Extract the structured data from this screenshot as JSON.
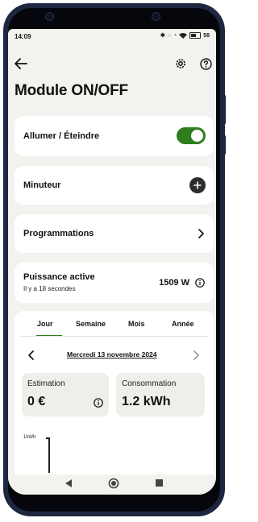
{
  "status_bar": {
    "time": "14:09",
    "battery": "58"
  },
  "page": {
    "title": "Module ON/OFF"
  },
  "icons": {
    "back": "arrow-left-icon",
    "settings": "gear-icon",
    "help": "question-circle-icon",
    "plus": "plus-icon",
    "chevron": "chevron-right-icon",
    "info": "info-circle-icon"
  },
  "switch_card": {
    "label": "Allumer / Éteindre",
    "state": "on"
  },
  "timer_card": {
    "label": "Minuteur"
  },
  "schedule_card": {
    "label": "Programmations"
  },
  "power_card": {
    "label": "Puissance active",
    "updated": "Il y a 18 secondes",
    "value": "1509 W"
  },
  "consumption": {
    "tabs": [
      {
        "label": "Jour",
        "active": true
      },
      {
        "label": "Semaine",
        "active": false
      },
      {
        "label": "Mois",
        "active": false
      },
      {
        "label": "Année",
        "active": false
      }
    ],
    "date": "Mercredi 13 novembre 2024",
    "estimation": {
      "label": "Estimation",
      "value": "0 €"
    },
    "consommation": {
      "label": "Consommation",
      "value": "1.2 kWh"
    },
    "chart_unit": "1kWh"
  },
  "colors": {
    "accent": "#2f7d1f",
    "background": "#f3f2ee",
    "card": "#ffffff"
  }
}
